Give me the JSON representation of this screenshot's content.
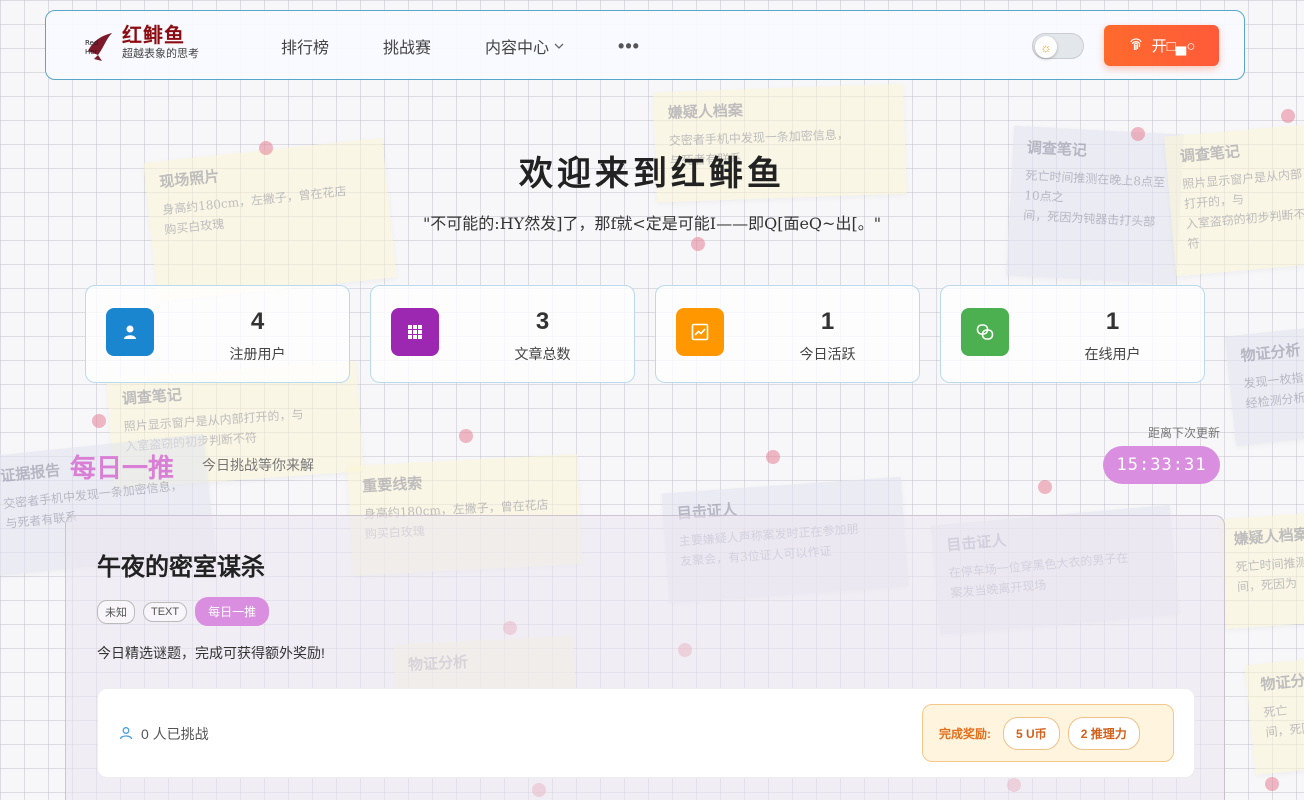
{
  "header": {
    "logo_title": "红鲱鱼",
    "logo_subtitle": "超越表象的思考",
    "nav": [
      {
        "label": "排行榜"
      },
      {
        "label": "挑战赛"
      },
      {
        "label": "内容中心"
      }
    ],
    "more_label": "•••",
    "toggle_icon": "sun-icon",
    "open_button_label": "开□▄○",
    "open_button_icon": "fingerprint-icon"
  },
  "hero": {
    "title": "欢迎来到红鲱鱼",
    "quote": "\"不可能的:HY然发]了，那f就<定是可能I——即Q[面eQ~出[。\""
  },
  "stats": [
    {
      "value": "4",
      "label": "注册用户",
      "icon": "user-icon",
      "color": "#1a86d0"
    },
    {
      "value": "3",
      "label": "文章总数",
      "icon": "grid-icon",
      "color": "#9c27b0"
    },
    {
      "value": "1",
      "label": "今日活跃",
      "icon": "chart-icon",
      "color": "#ff9800"
    },
    {
      "value": "1",
      "label": "在线用户",
      "icon": "link-icon",
      "color": "#4caf50"
    }
  ],
  "daily": {
    "title": "每日一推",
    "subtitle": "今日挑战等你来解",
    "countdown_label": "距离下次更新",
    "countdown": "15:33:31"
  },
  "puzzle": {
    "title": "午夜的密室谋杀",
    "tags": [
      "未知",
      "TEXT"
    ],
    "highlight_tag": "每日一推",
    "description": "今日精选谜题，完成可获得额外奖励!",
    "challengers": "0 人已挑战",
    "reward_label": "完成奖励:",
    "rewards": [
      "5 U币",
      "2 推理力"
    ]
  },
  "background_notes": [
    {
      "title": "嫌疑人档案",
      "body": "交密者手机中发现一条加密信息，\n与死者有联系"
    },
    {
      "title": "现场照片",
      "body": "身高约180cm，左撇子，曾在花店\n购买白玫瑰"
    },
    {
      "title": "调查笔记",
      "body": "死亡时间推测在晚上8点至10点之\n间，死因为钝器击打头部"
    },
    {
      "title": "调查笔记",
      "body": "照片显示窗户是从内部打开的，与\n入室盗窃的初步判断不符"
    },
    {
      "title": "调查笔记",
      "body": "照片显示窗户是从内部打开的，与\n入室盗窃的初步判断不符"
    },
    {
      "title": "重要线索",
      "body": "身高约180cm，左撇子，曾在花店\n购买白玫瑰"
    },
    {
      "title": "目击证人",
      "body": "主要嫌疑人声称案发时正在参加朋\n友聚会，有3位证人可以作证"
    },
    {
      "title": "目击证人",
      "body": "在停车场一位穿黑色大衣的男子在\n案发当晚离开现场"
    },
    {
      "title": "证据报告",
      "body": "交密者手机中发现一条加密信息，\n与死者有联系"
    },
    {
      "title": "物证分析",
      "body": "发现一枚指纹，\n经检测分析"
    },
    {
      "title": "嫌疑人档案",
      "body": "死亡时间推测\n间，死因为"
    },
    {
      "title": "物证分析",
      "body": ""
    },
    {
      "title": "物证分",
      "body": "死亡\n间，死因"
    }
  ]
}
